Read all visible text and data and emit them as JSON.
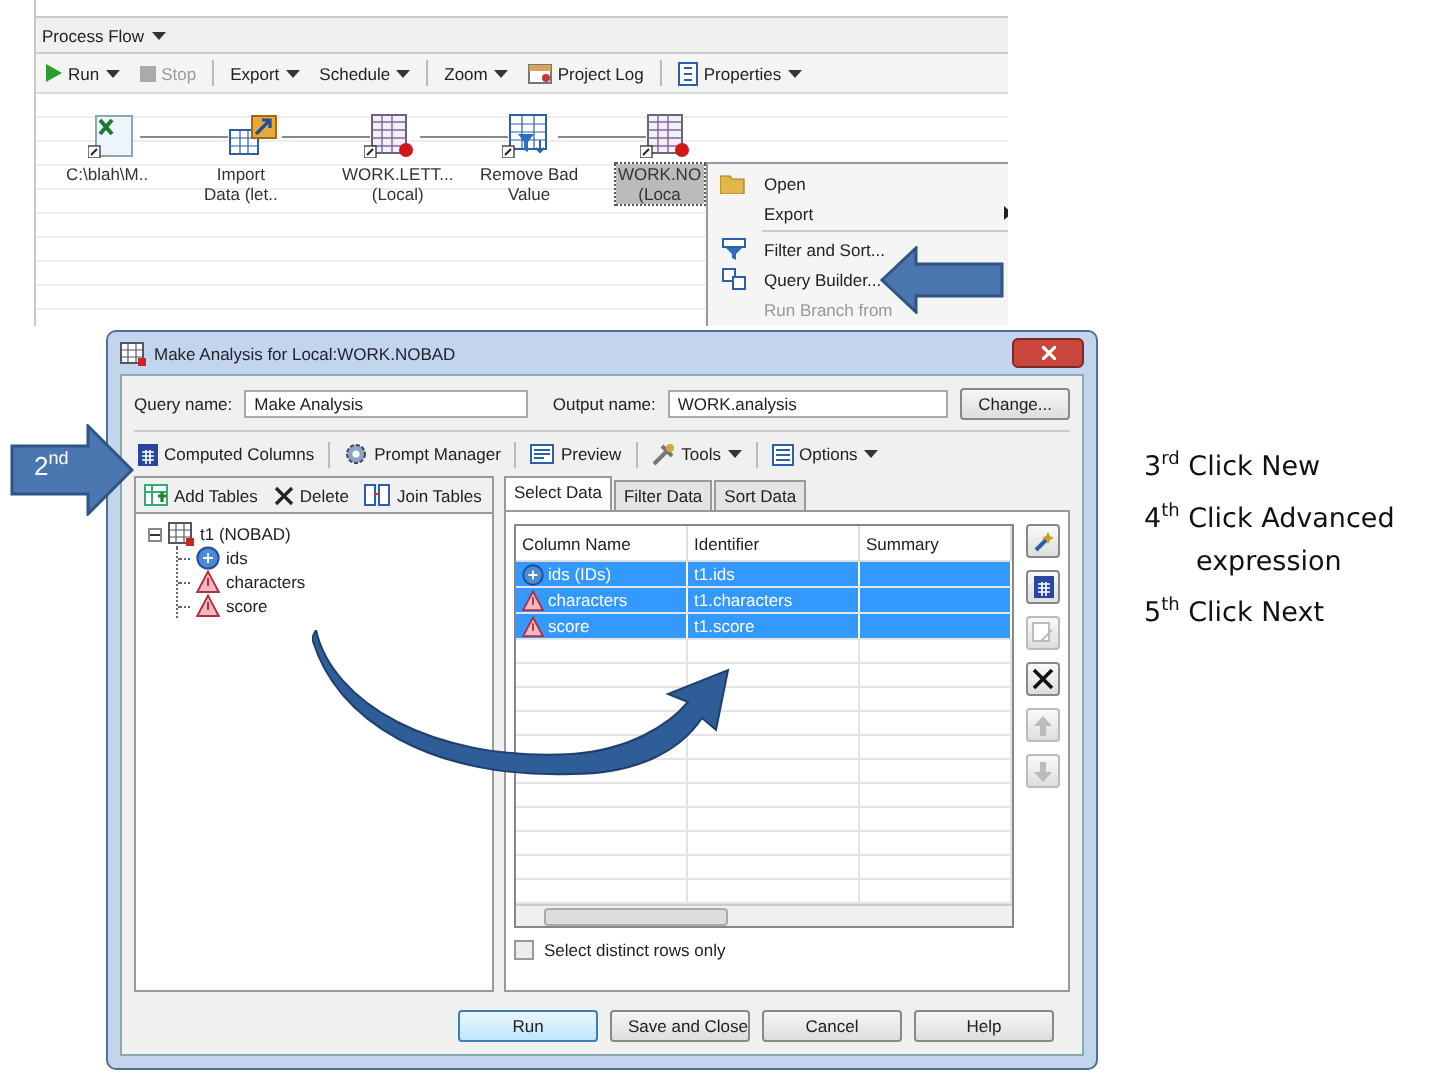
{
  "process_flow": {
    "title": "Process Flow",
    "toolbar": [
      {
        "label": "Run",
        "kind": "run",
        "dropdown": true,
        "disabled": false
      },
      {
        "label": "Stop",
        "kind": "stop",
        "dropdown": false,
        "disabled": true
      },
      {
        "label": "Export",
        "kind": "none",
        "dropdown": true,
        "disabled": false
      },
      {
        "label": "Schedule",
        "kind": "none",
        "dropdown": true,
        "disabled": false
      },
      {
        "label": "Zoom",
        "kind": "none",
        "dropdown": true,
        "disabled": false
      },
      {
        "label": "Project Log",
        "kind": "log",
        "dropdown": false,
        "disabled": false
      },
      {
        "label": "Properties",
        "kind": "properties",
        "dropdown": true,
        "disabled": false
      }
    ],
    "nodes": [
      {
        "kind": "excel",
        "lines": [
          "C:\\blah\\M.."
        ],
        "selected": false
      },
      {
        "kind": "import",
        "lines": [
          "Import",
          "Data (let.."
        ],
        "selected": false
      },
      {
        "kind": "dataset",
        "lines": [
          "WORK.LETT...",
          "(Local)"
        ],
        "selected": false
      },
      {
        "kind": "filter",
        "lines": [
          "Remove Bad",
          "Value"
        ],
        "selected": false
      },
      {
        "kind": "dataset",
        "lines": [
          "WORK.NO",
          "(Loca"
        ],
        "selected": true
      }
    ],
    "context_menu": [
      {
        "label": "Open",
        "kind": "folder",
        "disabled": false
      },
      {
        "label": "Export",
        "kind": "none",
        "submenu": true,
        "disabled": false
      },
      {
        "label": "Filter and Sort...",
        "kind": "filter",
        "disabled": false
      },
      {
        "label": "Query Builder...",
        "kind": "query",
        "disabled": false
      },
      {
        "label": "Run Branch from",
        "kind": "none",
        "disabled": true
      }
    ]
  },
  "dialog": {
    "title": "Make Analysis for Local:WORK.NOBAD",
    "query_name": {
      "label": "Query name:",
      "value": "Make Analysis"
    },
    "output_name": {
      "label": "Output name:",
      "value": "WORK.analysis"
    },
    "change_button": "Change...",
    "toolbar": [
      {
        "label": "Computed Columns",
        "kind": "calc",
        "dropdown": false
      },
      {
        "label": "Prompt Manager",
        "kind": "prompt",
        "dropdown": false
      },
      {
        "label": "Preview",
        "kind": "preview",
        "dropdown": false
      },
      {
        "label": "Tools",
        "kind": "tools",
        "dropdown": true
      },
      {
        "label": "Options",
        "kind": "options",
        "dropdown": true
      }
    ],
    "tables_toolbar": [
      {
        "label": "Add Tables",
        "kind": "add"
      },
      {
        "label": "Delete",
        "kind": "delete"
      },
      {
        "label": "Join Tables",
        "kind": "join"
      }
    ],
    "tree": [
      {
        "label": "t1 (NOBAD)",
        "kind": "table",
        "expanded": true,
        "children": [
          {
            "label": "ids",
            "kind": "numeric"
          },
          {
            "label": "characters",
            "kind": "char"
          },
          {
            "label": "score",
            "kind": "char"
          }
        ]
      }
    ],
    "tabs": [
      {
        "label": "Select Data",
        "selected": true
      },
      {
        "label": "Filter Data",
        "selected": false
      },
      {
        "label": "Sort Data",
        "selected": false
      }
    ],
    "columns": [
      "Column Name",
      "Identifier",
      "Summary"
    ],
    "rows": [
      {
        "kind": "numeric",
        "cells": [
          "ids (IDs)",
          "t1.ids",
          ""
        ],
        "selected": true
      },
      {
        "kind": "char",
        "cells": [
          "characters",
          "t1.characters",
          ""
        ],
        "selected": true
      },
      {
        "kind": "char",
        "cells": [
          "score",
          "t1.score",
          ""
        ],
        "selected": true
      }
    ],
    "side_buttons": [
      {
        "kind": "wand",
        "disabled": false
      },
      {
        "kind": "calc",
        "disabled": false
      },
      {
        "kind": "edit",
        "disabled": true
      },
      {
        "kind": "delete",
        "disabled": false
      },
      {
        "kind": "up",
        "disabled": true
      },
      {
        "kind": "down",
        "disabled": true
      }
    ],
    "distinct_rows": {
      "label": "Select distinct rows only",
      "checked": false
    },
    "buttons": [
      {
        "label": "Run",
        "default": true
      },
      {
        "label": "Save and Close",
        "default": false
      },
      {
        "label": "Cancel",
        "default": false
      },
      {
        "label": "Help",
        "default": false
      }
    ]
  },
  "step_callout": "2$^{nd}$",
  "notes": [
    "3$^{rd}$ Click New",
    "4$^{th}$ Click Advanced expression",
    "5$^{th}$ Click Next"
  ]
}
